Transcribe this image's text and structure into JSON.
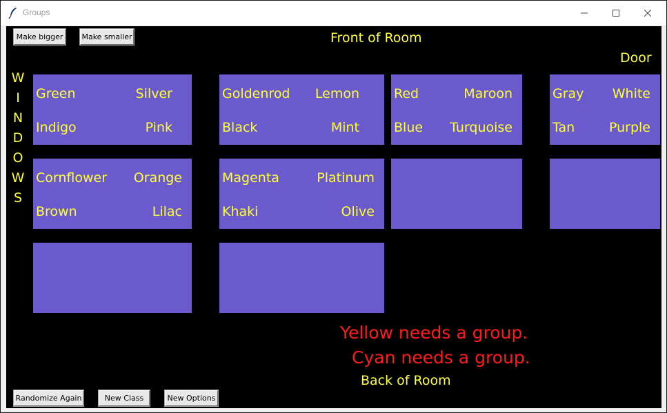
{
  "window": {
    "title": "Groups"
  },
  "toolbar": {
    "make_bigger": "Make bigger",
    "make_smaller": "Make smaller"
  },
  "room": {
    "front": "Front of Room",
    "door": "Door",
    "windows": [
      "W",
      "I",
      "N",
      "D",
      "O",
      "W",
      "S"
    ],
    "back": "Back of Room"
  },
  "tables": [
    {
      "names": [
        "Green",
        "Silver",
        "Indigo",
        "Pink"
      ]
    },
    {
      "names": [
        "Goldenrod",
        "Lemon",
        "Black",
        "Mint"
      ]
    },
    {
      "names": [
        "Red",
        "Maroon",
        "Blue",
        "Turquoise"
      ]
    },
    {
      "names": [
        "Gray",
        "White",
        "Tan",
        "Purple"
      ]
    },
    {
      "names": [
        "Cornflower",
        "Orange",
        "Brown",
        "Lilac"
      ]
    },
    {
      "names": [
        "Magenta",
        "Platinum",
        "Khaki",
        "Olive"
      ]
    },
    {
      "names": []
    },
    {
      "names": []
    },
    {
      "names": []
    },
    {
      "names": []
    }
  ],
  "messages": [
    "Yellow needs a group.",
    "Cyan needs a group."
  ],
  "buttons": {
    "randomize": "Randomize Again",
    "new_class": "New Class",
    "new_options": "New Options"
  },
  "colors": {
    "table": "#6a5acd",
    "text": "#ffff33",
    "warning": "#ff1a1a",
    "background": "#000000"
  }
}
